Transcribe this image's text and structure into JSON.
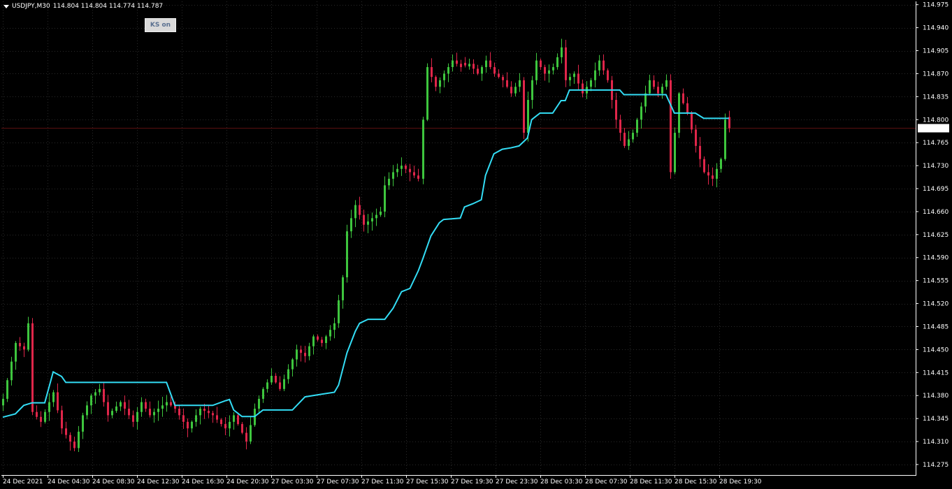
{
  "header": {
    "symbol": "USDJPY,M30",
    "ohlc": "114.804 114.804 114.774 114.787"
  },
  "button": {
    "label": "KS on"
  },
  "colors": {
    "bull": "#3ec63e",
    "bear": "#e0264a",
    "kijun": "#33ddf5",
    "grid": "#2a2a2a",
    "price_line": "#5a1010",
    "axis": "#ffffff"
  },
  "chart_data": {
    "type": "candlestick",
    "symbol": "USDJPY",
    "timeframe": "M30",
    "ylim": [
      114.259,
      114.98
    ],
    "y_ticks": [
      "114.975",
      "114.940",
      "114.905",
      "114.870",
      "114.835",
      "114.800",
      "114.765",
      "114.730",
      "114.695",
      "114.660",
      "114.625",
      "114.590",
      "114.555",
      "114.520",
      "114.485",
      "114.450",
      "114.415",
      "114.380",
      "114.345",
      "114.310",
      "114.275"
    ],
    "x_ticks": [
      "24 Dec 2021",
      "24 Dec 04:30",
      "24 Dec 08:30",
      "24 Dec 12:30",
      "24 Dec 16:30",
      "24 Dec 20:30",
      "27 Dec 03:30",
      "27 Dec 07:30",
      "27 Dec 11:30",
      "27 Dec 15:30",
      "27 Dec 19:30",
      "27 Dec 23:30",
      "28 Dec 03:30",
      "28 Dec 07:30",
      "28 Dec 11:30",
      "28 Dec 15:30",
      "28 Dec 19:30"
    ],
    "current_price": "114.787",
    "anchors": [
      {
        "i": 0,
        "c": 114.375
      },
      {
        "i": 3,
        "c": 114.46
      },
      {
        "i": 5,
        "c": 114.45
      },
      {
        "i": 6,
        "c": 114.49
      },
      {
        "i": 7,
        "c": 114.355
      },
      {
        "i": 9,
        "c": 114.34
      },
      {
        "i": 12,
        "c": 114.385
      },
      {
        "i": 14,
        "c": 114.33
      },
      {
        "i": 17,
        "c": 114.3
      },
      {
        "i": 19,
        "c": 114.35
      },
      {
        "i": 21,
        "c": 114.38
      },
      {
        "i": 23,
        "c": 114.39
      },
      {
        "i": 25,
        "c": 114.35
      },
      {
        "i": 28,
        "c": 114.37
      },
      {
        "i": 31,
        "c": 114.34
      },
      {
        "i": 33,
        "c": 114.37
      },
      {
        "i": 35,
        "c": 114.35
      },
      {
        "i": 37,
        "c": 114.36
      },
      {
        "i": 39,
        "c": 114.37
      },
      {
        "i": 41,
        "c": 114.36
      },
      {
        "i": 44,
        "c": 114.33
      },
      {
        "i": 47,
        "c": 114.36
      },
      {
        "i": 50,
        "c": 114.35
      },
      {
        "i": 53,
        "c": 114.33
      },
      {
        "i": 55,
        "c": 114.35
      },
      {
        "i": 58,
        "c": 114.31
      },
      {
        "i": 60,
        "c": 114.36
      },
      {
        "i": 62,
        "c": 114.39
      },
      {
        "i": 64,
        "c": 114.41
      },
      {
        "i": 66,
        "c": 114.39
      },
      {
        "i": 68,
        "c": 114.42
      },
      {
        "i": 70,
        "c": 114.45
      },
      {
        "i": 72,
        "c": 114.44
      },
      {
        "i": 74,
        "c": 114.47
      },
      {
        "i": 76,
        "c": 114.46
      },
      {
        "i": 78,
        "c": 114.48
      },
      {
        "i": 79,
        "c": 114.49
      },
      {
        "i": 81,
        "c": 114.56
      },
      {
        "i": 82,
        "c": 114.63
      },
      {
        "i": 84,
        "c": 114.67
      },
      {
        "i": 86,
        "c": 114.64
      },
      {
        "i": 88,
        "c": 114.65
      },
      {
        "i": 90,
        "c": 114.66
      },
      {
        "i": 91,
        "c": 114.7
      },
      {
        "i": 93,
        "c": 114.72
      },
      {
        "i": 95,
        "c": 114.73
      },
      {
        "i": 97,
        "c": 114.72
      },
      {
        "i": 99,
        "c": 114.71
      },
      {
        "i": 100,
        "c": 114.8
      },
      {
        "i": 101,
        "c": 114.88
      },
      {
        "i": 103,
        "c": 114.85
      },
      {
        "i": 105,
        "c": 114.87
      },
      {
        "i": 107,
        "c": 114.89
      },
      {
        "i": 109,
        "c": 114.88
      },
      {
        "i": 111,
        "c": 114.885
      },
      {
        "i": 113,
        "c": 114.87
      },
      {
        "i": 115,
        "c": 114.89
      },
      {
        "i": 117,
        "c": 114.87
      },
      {
        "i": 119,
        "c": 114.86
      },
      {
        "i": 121,
        "c": 114.84
      },
      {
        "i": 123,
        "c": 114.86
      },
      {
        "i": 124,
        "c": 114.78
      },
      {
        "i": 125,
        "c": 114.83
      },
      {
        "i": 127,
        "c": 114.89
      },
      {
        "i": 129,
        "c": 114.87
      },
      {
        "i": 131,
        "c": 114.88
      },
      {
        "i": 133,
        "c": 114.91
      },
      {
        "i": 134,
        "c": 114.86
      },
      {
        "i": 136,
        "c": 114.87
      },
      {
        "i": 138,
        "c": 114.84
      },
      {
        "i": 140,
        "c": 114.86
      },
      {
        "i": 142,
        "c": 114.89
      },
      {
        "i": 144,
        "c": 114.86
      },
      {
        "i": 146,
        "c": 114.8
      },
      {
        "i": 148,
        "c": 114.76
      },
      {
        "i": 150,
        "c": 114.78
      },
      {
        "i": 152,
        "c": 114.82
      },
      {
        "i": 154,
        "c": 114.86
      },
      {
        "i": 156,
        "c": 114.84
      },
      {
        "i": 158,
        "c": 114.86
      },
      {
        "i": 159,
        "c": 114.72
      },
      {
        "i": 161,
        "c": 114.84
      },
      {
        "i": 163,
        "c": 114.81
      },
      {
        "i": 165,
        "c": 114.76
      },
      {
        "i": 167,
        "c": 114.72
      },
      {
        "i": 169,
        "c": 114.71
      },
      {
        "i": 171,
        "c": 114.74
      },
      {
        "i": 172,
        "c": 114.8
      },
      {
        "i": 173,
        "c": 114.787
      }
    ],
    "kijun": [
      [
        0,
        114.347
      ],
      [
        3,
        114.352
      ],
      [
        5,
        114.365
      ],
      [
        7,
        114.369
      ],
      [
        10,
        114.369
      ],
      [
        12,
        114.416
      ],
      [
        14,
        114.409
      ],
      [
        15,
        114.4
      ],
      [
        39,
        114.4
      ],
      [
        41,
        114.365
      ],
      [
        50,
        114.365
      ],
      [
        53,
        114.372
      ],
      [
        54,
        114.374
      ],
      [
        55,
        114.358
      ],
      [
        57,
        114.348
      ],
      [
        60,
        114.348
      ],
      [
        62,
        114.358
      ],
      [
        69,
        114.358
      ],
      [
        72,
        114.378
      ],
      [
        76,
        114.382
      ],
      [
        79,
        114.385
      ],
      [
        80,
        114.396
      ],
      [
        82,
        114.445
      ],
      [
        84,
        114.478
      ],
      [
        85,
        114.49
      ],
      [
        87,
        114.496
      ],
      [
        91,
        114.496
      ],
      [
        93,
        114.513
      ],
      [
        95,
        114.538
      ],
      [
        97,
        114.543
      ],
      [
        99,
        114.57
      ],
      [
        100,
        114.587
      ],
      [
        102,
        114.623
      ],
      [
        104,
        114.643
      ],
      [
        105,
        114.648
      ],
      [
        109,
        114.65
      ],
      [
        110,
        114.667
      ],
      [
        112,
        114.672
      ],
      [
        114,
        114.678
      ],
      [
        115,
        114.715
      ],
      [
        117,
        114.748
      ],
      [
        119,
        114.755
      ],
      [
        121,
        114.757
      ],
      [
        123,
        114.76
      ],
      [
        125,
        114.772
      ],
      [
        126,
        114.8
      ],
      [
        128,
        114.81
      ],
      [
        131,
        114.81
      ],
      [
        133,
        114.829
      ],
      [
        134,
        114.829
      ],
      [
        135,
        114.845
      ],
      [
        147,
        114.845
      ],
      [
        148,
        114.838
      ],
      [
        158,
        114.838
      ],
      [
        160,
        114.81
      ],
      [
        165,
        114.81
      ],
      [
        167,
        114.802
      ],
      [
        173,
        114.802
      ]
    ]
  }
}
